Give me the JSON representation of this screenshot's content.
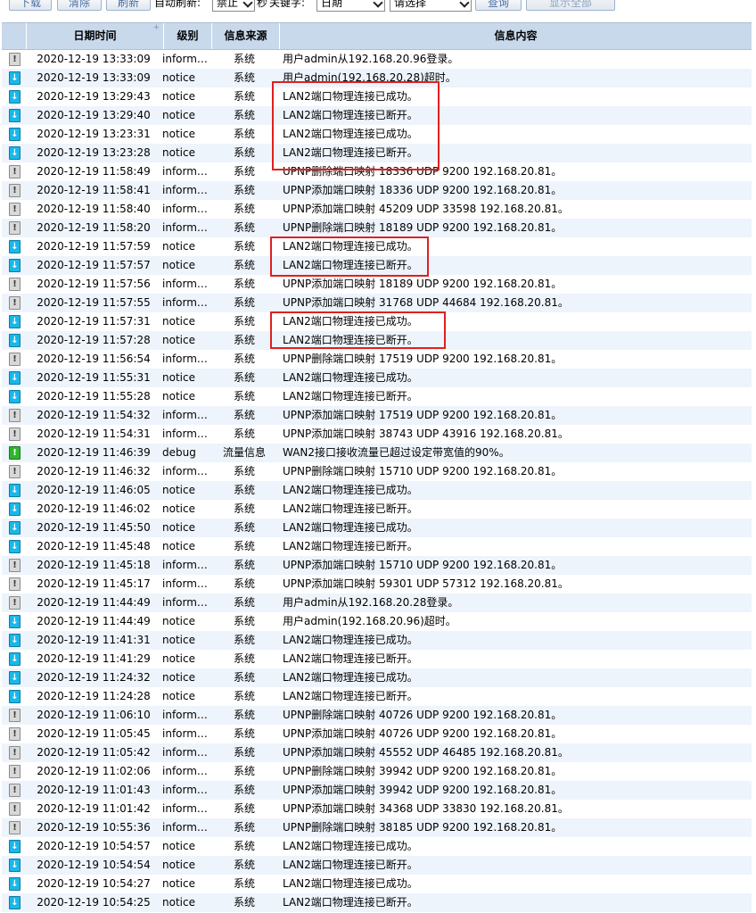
{
  "toolbar": {
    "download": "下载",
    "clear": "清除",
    "refresh": "刷新",
    "auto_refresh_label": "自动刷新:",
    "auto_refresh_value": "禁止",
    "seconds_label": "秒",
    "keyword_label": "关键字:",
    "keyword_field_value": "日期",
    "keyword_select_value": "请选择",
    "query": "查询",
    "show_all": "显示全部"
  },
  "table": {
    "headers": {
      "datetime": "日期时间",
      "level": "级别",
      "source": "信息来源",
      "content": "信息内容"
    },
    "rows": [
      {
        "type": "info",
        "datetime": "2020-12-19 13:33:09",
        "level": "inform…",
        "source": "系统",
        "content": "用户admin从192.168.20.96登录。"
      },
      {
        "type": "notice",
        "datetime": "2020-12-19 13:33:09",
        "level": "notice",
        "source": "系统",
        "content": "用户admin(192.168.20.28)超时。"
      },
      {
        "type": "notice",
        "datetime": "2020-12-19 13:29:43",
        "level": "notice",
        "source": "系统",
        "content": "LAN2端口物理连接已成功。"
      },
      {
        "type": "notice",
        "datetime": "2020-12-19 13:29:40",
        "level": "notice",
        "source": "系统",
        "content": "LAN2端口物理连接已断开。"
      },
      {
        "type": "notice",
        "datetime": "2020-12-19 13:23:31",
        "level": "notice",
        "source": "系统",
        "content": "LAN2端口物理连接已成功。"
      },
      {
        "type": "notice",
        "datetime": "2020-12-19 13:23:28",
        "level": "notice",
        "source": "系统",
        "content": "LAN2端口物理连接已断开。"
      },
      {
        "type": "info",
        "datetime": "2020-12-19 11:58:49",
        "level": "inform…",
        "source": "系统",
        "content": "UPNP删除端口映射 18336 UDP 9200 192.168.20.81。"
      },
      {
        "type": "info",
        "datetime": "2020-12-19 11:58:41",
        "level": "inform…",
        "source": "系统",
        "content": "UPNP添加端口映射 18336 UDP 9200 192.168.20.81。"
      },
      {
        "type": "info",
        "datetime": "2020-12-19 11:58:40",
        "level": "inform…",
        "source": "系统",
        "content": "UPNP添加端口映射 45209 UDP 33598 192.168.20.81。"
      },
      {
        "type": "info",
        "datetime": "2020-12-19 11:58:20",
        "level": "inform…",
        "source": "系统",
        "content": "UPNP删除端口映射 18189 UDP 9200 192.168.20.81。"
      },
      {
        "type": "notice",
        "datetime": "2020-12-19 11:57:59",
        "level": "notice",
        "source": "系统",
        "content": "LAN2端口物理连接已成功。"
      },
      {
        "type": "notice",
        "datetime": "2020-12-19 11:57:57",
        "level": "notice",
        "source": "系统",
        "content": "LAN2端口物理连接已断开。"
      },
      {
        "type": "info",
        "datetime": "2020-12-19 11:57:56",
        "level": "inform…",
        "source": "系统",
        "content": "UPNP添加端口映射 18189 UDP 9200 192.168.20.81。"
      },
      {
        "type": "info",
        "datetime": "2020-12-19 11:57:55",
        "level": "inform…",
        "source": "系统",
        "content": "UPNP添加端口映射 31768 UDP 44684 192.168.20.81。"
      },
      {
        "type": "notice",
        "datetime": "2020-12-19 11:57:31",
        "level": "notice",
        "source": "系统",
        "content": "LAN2端口物理连接已成功。"
      },
      {
        "type": "notice",
        "datetime": "2020-12-19 11:57:28",
        "level": "notice",
        "source": "系统",
        "content": "LAN2端口物理连接已断开。"
      },
      {
        "type": "info",
        "datetime": "2020-12-19 11:56:54",
        "level": "inform…",
        "source": "系统",
        "content": "UPNP删除端口映射 17519 UDP 9200 192.168.20.81。"
      },
      {
        "type": "notice",
        "datetime": "2020-12-19 11:55:31",
        "level": "notice",
        "source": "系统",
        "content": "LAN2端口物理连接已成功。"
      },
      {
        "type": "notice",
        "datetime": "2020-12-19 11:55:28",
        "level": "notice",
        "source": "系统",
        "content": "LAN2端口物理连接已断开。"
      },
      {
        "type": "info",
        "datetime": "2020-12-19 11:54:32",
        "level": "inform…",
        "source": "系统",
        "content": "UPNP添加端口映射 17519 UDP 9200 192.168.20.81。"
      },
      {
        "type": "info",
        "datetime": "2020-12-19 11:54:31",
        "level": "inform…",
        "source": "系统",
        "content": "UPNP添加端口映射 38743 UDP 43916 192.168.20.81。"
      },
      {
        "type": "debug",
        "datetime": "2020-12-19 11:46:39",
        "level": "debug",
        "source": "流量信息",
        "content": "WAN2接口接收流量已超过设定带宽值的90%。"
      },
      {
        "type": "info",
        "datetime": "2020-12-19 11:46:32",
        "level": "inform…",
        "source": "系统",
        "content": "UPNP删除端口映射 15710 UDP 9200 192.168.20.81。"
      },
      {
        "type": "notice",
        "datetime": "2020-12-19 11:46:05",
        "level": "notice",
        "source": "系统",
        "content": "LAN2端口物理连接已成功。"
      },
      {
        "type": "notice",
        "datetime": "2020-12-19 11:46:02",
        "level": "notice",
        "source": "系统",
        "content": "LAN2端口物理连接已断开。"
      },
      {
        "type": "notice",
        "datetime": "2020-12-19 11:45:50",
        "level": "notice",
        "source": "系统",
        "content": "LAN2端口物理连接已成功。"
      },
      {
        "type": "notice",
        "datetime": "2020-12-19 11:45:48",
        "level": "notice",
        "source": "系统",
        "content": "LAN2端口物理连接已断开。"
      },
      {
        "type": "info",
        "datetime": "2020-12-19 11:45:18",
        "level": "inform…",
        "source": "系统",
        "content": "UPNP添加端口映射 15710 UDP 9200 192.168.20.81。"
      },
      {
        "type": "info",
        "datetime": "2020-12-19 11:45:17",
        "level": "inform…",
        "source": "系统",
        "content": "UPNP添加端口映射 59301 UDP 57312 192.168.20.81。"
      },
      {
        "type": "info",
        "datetime": "2020-12-19 11:44:49",
        "level": "inform…",
        "source": "系统",
        "content": "用户admin从192.168.20.28登录。"
      },
      {
        "type": "notice",
        "datetime": "2020-12-19 11:44:49",
        "level": "notice",
        "source": "系统",
        "content": "用户admin(192.168.20.96)超时。"
      },
      {
        "type": "notice",
        "datetime": "2020-12-19 11:41:31",
        "level": "notice",
        "source": "系统",
        "content": "LAN2端口物理连接已成功。"
      },
      {
        "type": "notice",
        "datetime": "2020-12-19 11:41:29",
        "level": "notice",
        "source": "系统",
        "content": "LAN2端口物理连接已断开。"
      },
      {
        "type": "notice",
        "datetime": "2020-12-19 11:24:32",
        "level": "notice",
        "source": "系统",
        "content": "LAN2端口物理连接已成功。"
      },
      {
        "type": "notice",
        "datetime": "2020-12-19 11:24:28",
        "level": "notice",
        "source": "系统",
        "content": "LAN2端口物理连接已断开。"
      },
      {
        "type": "info",
        "datetime": "2020-12-19 11:06:10",
        "level": "inform…",
        "source": "系统",
        "content": "UPNP删除端口映射 40726 UDP 9200 192.168.20.81。"
      },
      {
        "type": "info",
        "datetime": "2020-12-19 11:05:45",
        "level": "inform…",
        "source": "系统",
        "content": "UPNP添加端口映射 40726 UDP 9200 192.168.20.81。"
      },
      {
        "type": "info",
        "datetime": "2020-12-19 11:05:42",
        "level": "inform…",
        "source": "系统",
        "content": "UPNP添加端口映射 45552 UDP 46485 192.168.20.81。"
      },
      {
        "type": "info",
        "datetime": "2020-12-19 11:02:06",
        "level": "inform…",
        "source": "系统",
        "content": "UPNP删除端口映射 39942 UDP 9200 192.168.20.81。"
      },
      {
        "type": "info",
        "datetime": "2020-12-19 11:01:43",
        "level": "inform…",
        "source": "系统",
        "content": "UPNP添加端口映射 39942 UDP 9200 192.168.20.81。"
      },
      {
        "type": "info",
        "datetime": "2020-12-19 11:01:42",
        "level": "inform…",
        "source": "系统",
        "content": "UPNP添加端口映射 34368 UDP 33830 192.168.20.81。"
      },
      {
        "type": "info",
        "datetime": "2020-12-19 10:55:36",
        "level": "inform…",
        "source": "系统",
        "content": "UPNP删除端口映射 38185 UDP 9200 192.168.20.81。"
      },
      {
        "type": "notice",
        "datetime": "2020-12-19 10:54:57",
        "level": "notice",
        "source": "系统",
        "content": "LAN2端口物理连接已成功。"
      },
      {
        "type": "notice",
        "datetime": "2020-12-19 10:54:54",
        "level": "notice",
        "source": "系统",
        "content": "LAN2端口物理连接已断开。"
      },
      {
        "type": "notice",
        "datetime": "2020-12-19 10:54:27",
        "level": "notice",
        "source": "系统",
        "content": "LAN2端口物理连接已成功。"
      },
      {
        "type": "notice",
        "datetime": "2020-12-19 10:54:25",
        "level": "notice",
        "source": "系统",
        "content": "LAN2端口物理连接已断开。"
      }
    ]
  },
  "colors": {
    "header_bg": "#c9d9ec",
    "alt_row_bg": "#eef4fb",
    "highlight_border": "#e02020",
    "notice_icon": "#19b8e8",
    "info_icon": "#d8d8d8",
    "debug_icon": "#2fb52f"
  }
}
